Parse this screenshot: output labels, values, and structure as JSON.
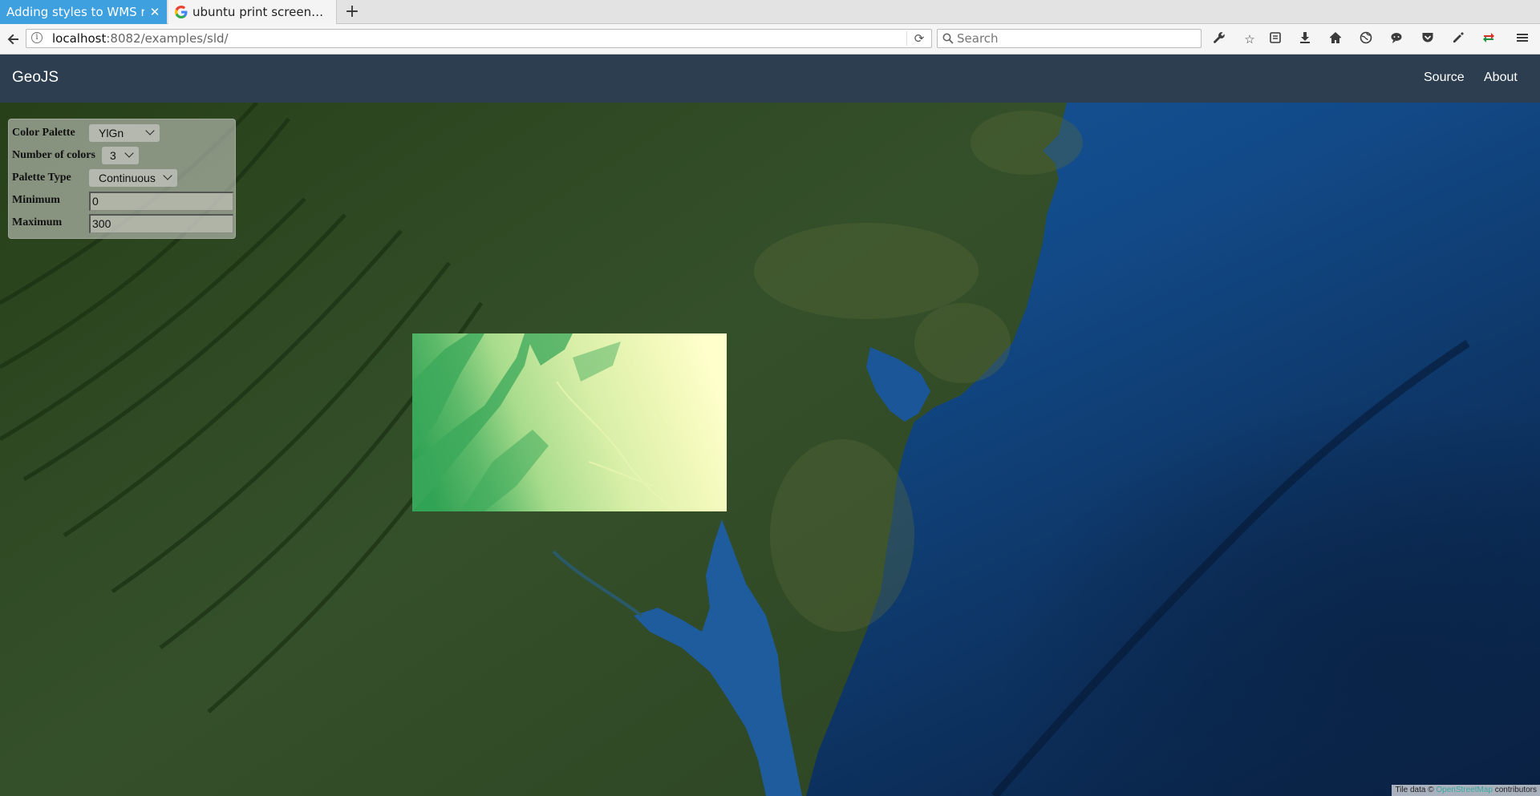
{
  "browser": {
    "tabs": [
      {
        "title": "Adding styles to WMS r…",
        "active": true
      },
      {
        "title": "ubuntu print screen…",
        "active": false
      }
    ],
    "url_host": "localhost",
    "url_rest": ":8082/examples/sld/",
    "search_placeholder": "Search",
    "toolbar_icons": [
      "wrench-icon",
      "bookmark-star-icon",
      "reading-list-icon",
      "download-icon",
      "home-icon",
      "globe-icon",
      "chat-icon",
      "pocket-icon",
      "extension-icon",
      "sync-icon",
      "menu-icon"
    ]
  },
  "app": {
    "brand": "GeoJS",
    "links": {
      "source": "Source",
      "about": "About"
    },
    "header_color": "#2c3e50"
  },
  "controls": {
    "color_palette_label": "Color Palette",
    "color_palette_value": "YlGn",
    "num_colors_label": "Number of colors",
    "num_colors_value": "3",
    "palette_type_label": "Palette Type",
    "palette_type_value": "Continuous",
    "minimum_label": "Minimum",
    "minimum_value": "0",
    "maximum_label": "Maximum",
    "maximum_value": "300"
  },
  "attribution": {
    "prefix": "Tile data ©",
    "link": "OpenStreetMap",
    "suffix": "contributors"
  },
  "colors": {
    "tab_active": "#3ea0df",
    "ocean": "#0f4a86",
    "land": "#2f4a22",
    "raster_low": "#ffffcc",
    "raster_high": "#31a354"
  }
}
